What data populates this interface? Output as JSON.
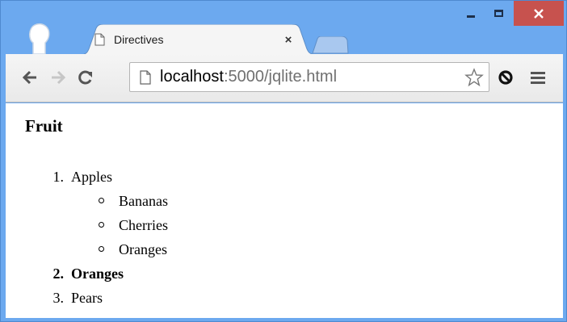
{
  "window": {
    "buttons": {
      "minimize": "minimize",
      "maximize": "maximize",
      "close": "close"
    },
    "colors": {
      "frame": "#6ca9ef",
      "close": "#c7524e"
    }
  },
  "tab": {
    "title": "Directives",
    "close_glyph": "×",
    "favicon": "page-icon"
  },
  "toolbar": {
    "back_icon": "back-arrow-icon",
    "forward_icon": "forward-arrow-icon",
    "reload_icon": "reload-icon",
    "url_host": "localhost",
    "url_rest": ":5000/jqlite.html",
    "bookmark_icon": "star-icon",
    "extension_icon": "extension-icon",
    "menu_icon": "hamburger-menu-icon"
  },
  "page": {
    "heading": "Fruit",
    "items": [
      {
        "number": "1.",
        "label": "Apples",
        "bold": false,
        "children": [
          "Bananas",
          "Cherries",
          "Oranges"
        ]
      },
      {
        "number": "2.",
        "label": "Oranges",
        "bold": true
      },
      {
        "number": "3.",
        "label": "Pears",
        "bold": false
      }
    ]
  }
}
